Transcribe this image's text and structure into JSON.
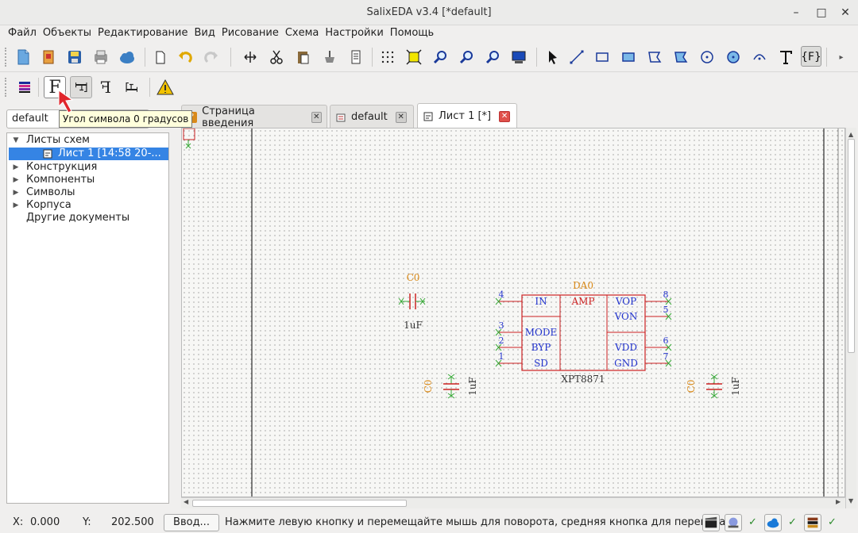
{
  "window": {
    "title": "SalixEDA v3.4 [*default]",
    "minimize": "–",
    "maximize": "□",
    "close": "✕"
  },
  "menu": [
    "Файл",
    "Объекты",
    "Редактирование",
    "Вид",
    "Рисование",
    "Схема",
    "Настройки",
    "Помощь"
  ],
  "toolbar2": {
    "btn_f0": "F",
    "btn_f90": "F",
    "btn_f180": "F",
    "btn_f270": "F"
  },
  "project_selector": {
    "value": "default"
  },
  "tooltip": {
    "text": "Угол символа 0 градусов"
  },
  "tree": {
    "items": [
      {
        "label": "Листы схем",
        "expanded": true
      },
      {
        "label": "Лист 1 [14:58 20-...",
        "selected": true
      },
      {
        "label": "Конструкция"
      },
      {
        "label": "Компоненты"
      },
      {
        "label": "Символы"
      },
      {
        "label": "Корпуса"
      },
      {
        "label": "Другие документы"
      }
    ]
  },
  "tabs": [
    {
      "label": "Страница введения",
      "close": "✕"
    },
    {
      "label": "default",
      "close": "✕"
    },
    {
      "label": "Лист 1 [*]",
      "close": "✕",
      "active": true
    }
  ],
  "schematic": {
    "chip": {
      "ref": "DA0",
      "value": "XPT8871",
      "center_label": "AMP",
      "left_pins": [
        {
          "num": "4",
          "name": "IN"
        },
        {
          "num": "3",
          "name": "MODE"
        },
        {
          "num": "2",
          "name": "BYP"
        },
        {
          "num": "1",
          "name": "SD"
        }
      ],
      "right_pins": [
        {
          "num": "8",
          "name": "VOP"
        },
        {
          "num": "5",
          "name": "VON"
        },
        {
          "num": "6",
          "name": "VDD"
        },
        {
          "num": "7",
          "name": "GND"
        }
      ]
    },
    "capacitors": [
      {
        "ref": "C0",
        "value": "1uF"
      },
      {
        "ref": "C0",
        "value": "1uF"
      },
      {
        "ref": "C0",
        "value": "1uF"
      }
    ]
  },
  "status": {
    "x_label": "X:",
    "x_value": "0.000",
    "y_label": "Y:",
    "y_value": "202.500",
    "input_button": "Ввод...",
    "message": "Нажмите левую кнопку и перемещайте мышь для поворота, средняя кнопка для переноса",
    "check": "✓"
  },
  "colors": {
    "schematic_red": "#cc2222",
    "schematic_blue": "#2233cc",
    "schematic_orange": "#d98a1a",
    "schematic_green": "#3aaa3a",
    "selection": "#3584e4",
    "pointer_arrow": "#e0262c"
  }
}
